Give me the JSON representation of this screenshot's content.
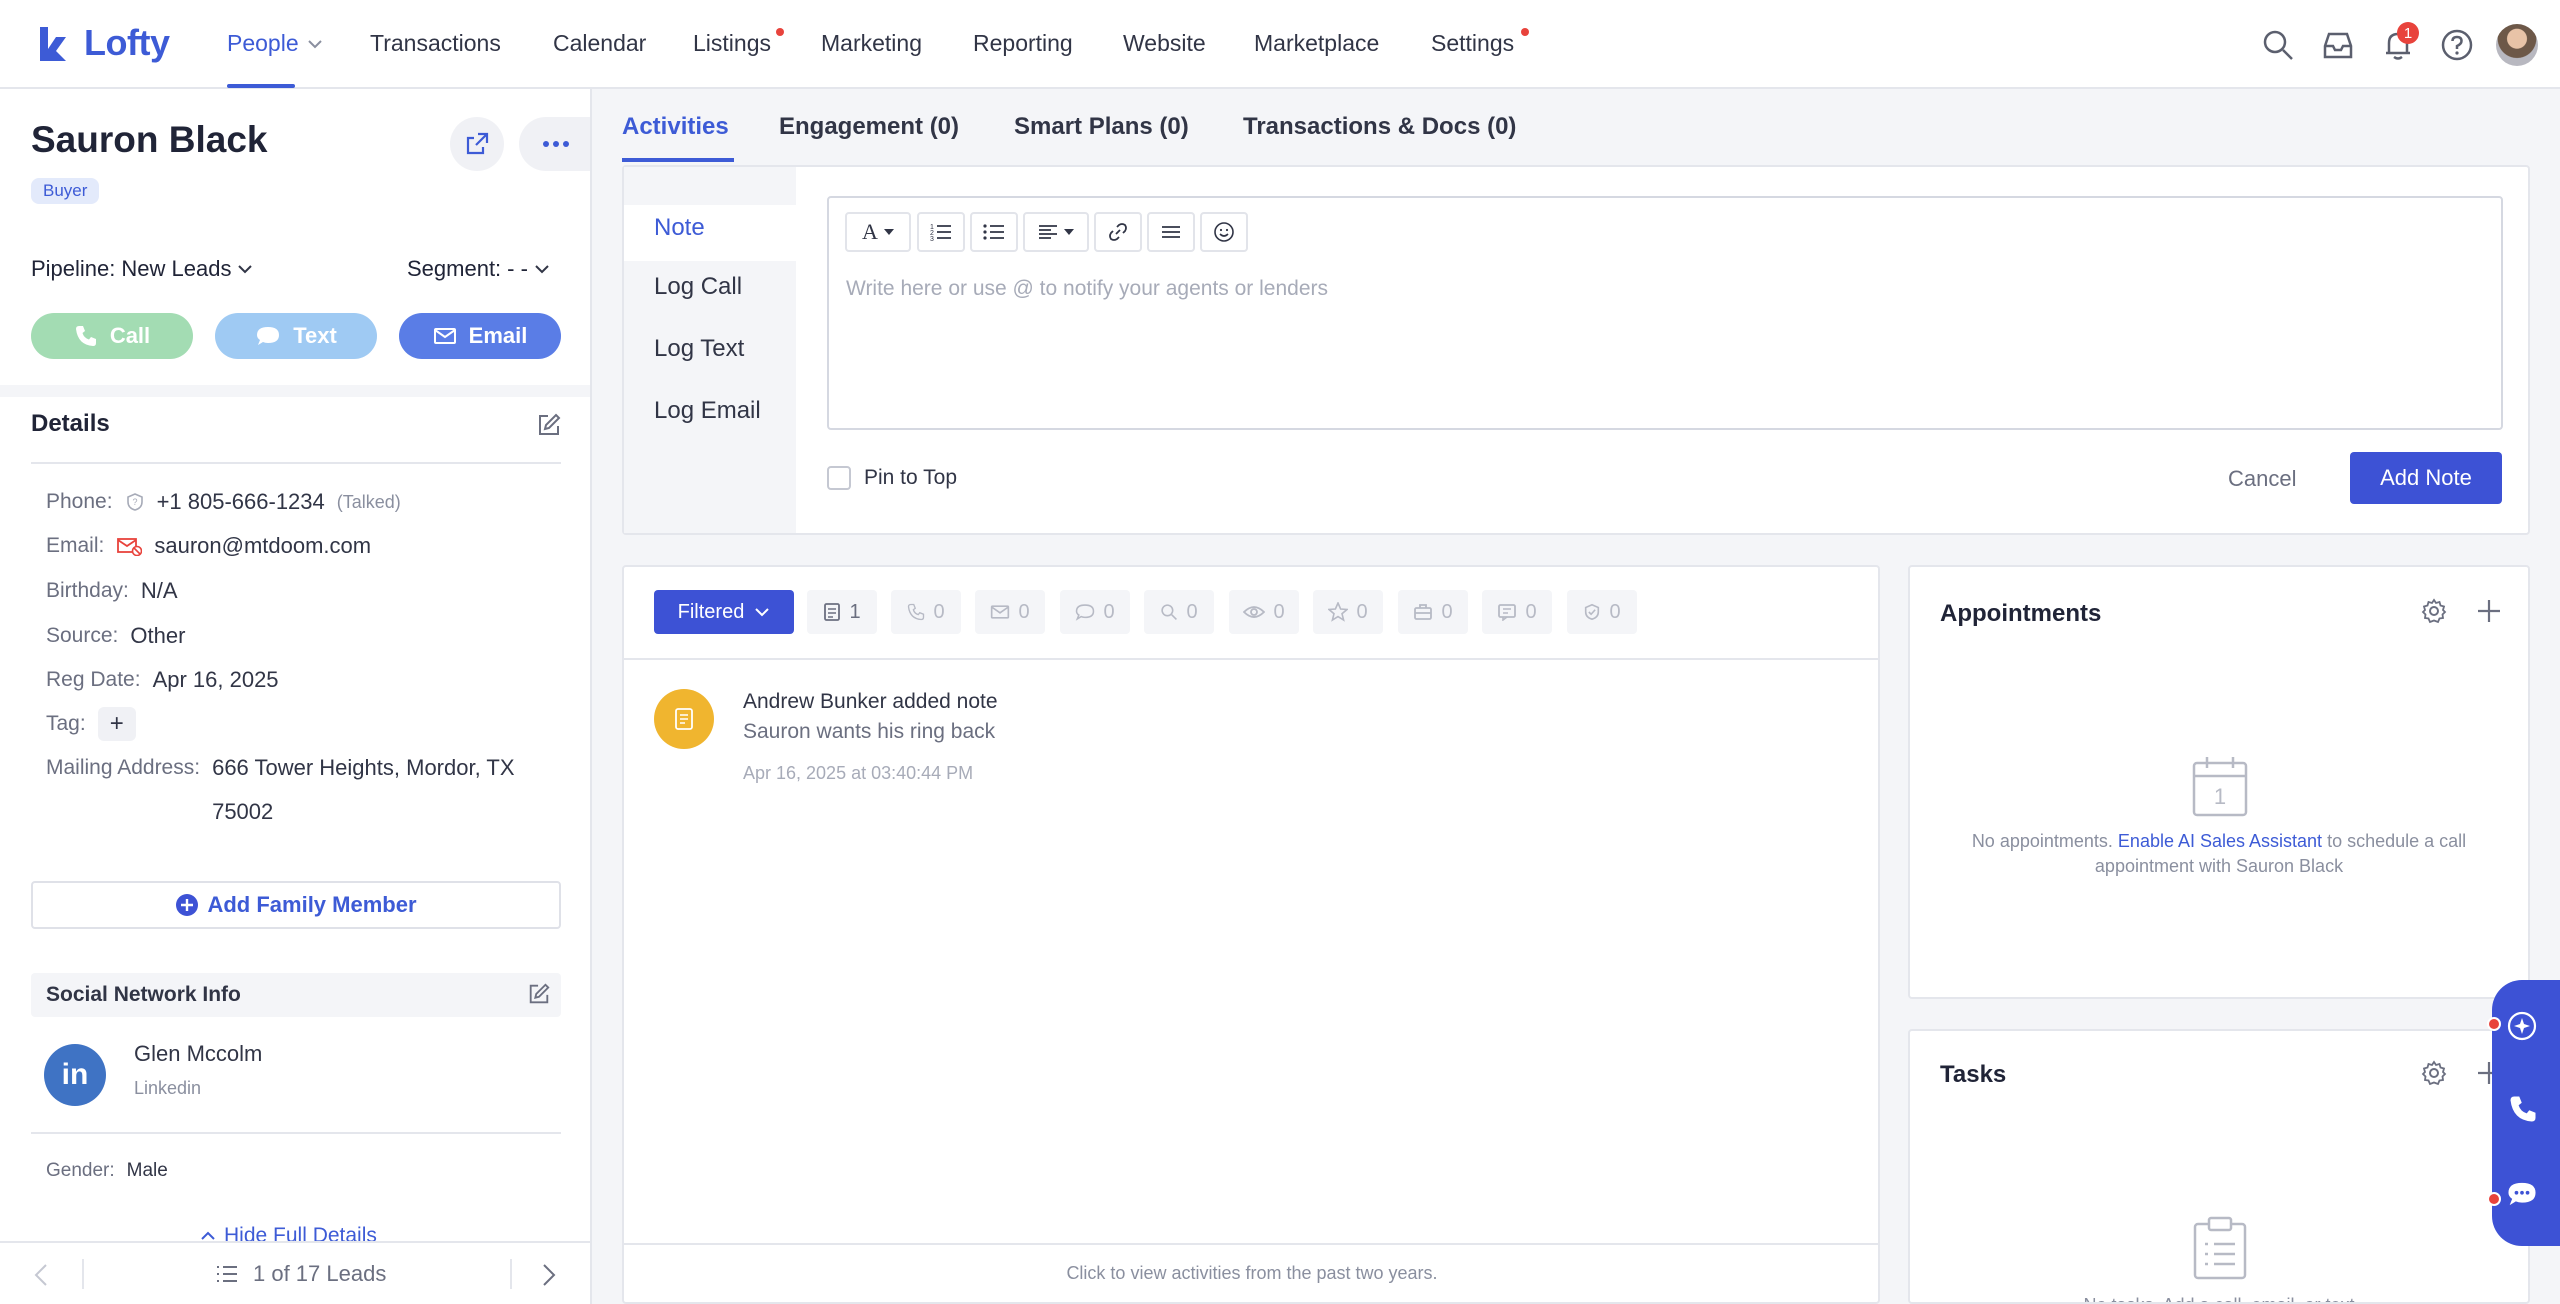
{
  "app": {
    "logo_text": "Lofty"
  },
  "nav": {
    "items": [
      {
        "label": "People"
      },
      {
        "label": "Transactions"
      },
      {
        "label": "Calendar"
      },
      {
        "label": "Listings"
      },
      {
        "label": "Marketing"
      },
      {
        "label": "Reporting"
      },
      {
        "label": "Website"
      },
      {
        "label": "Marketplace"
      },
      {
        "label": "Settings"
      }
    ],
    "notification_count": "1"
  },
  "contact": {
    "name": "Sauron Black",
    "badge": "Buyer",
    "pipeline_label": "Pipeline:",
    "pipeline_value": "New Leads",
    "segment_label": "Segment:",
    "segment_value": "- -",
    "call_label": "Call",
    "text_label": "Text",
    "email_label": "Email"
  },
  "details": {
    "title": "Details",
    "phone_label": "Phone:",
    "phone_value": "+1 805-666-1234",
    "phone_status": "(Talked)",
    "email_label": "Email:",
    "email_value": "sauron@mtdoom.com",
    "birthday_label": "Birthday:",
    "birthday_value": "N/A",
    "source_label": "Source:",
    "source_value": "Other",
    "reg_label": "Reg Date:",
    "reg_value": "Apr 16, 2025",
    "tag_label": "Tag:",
    "address_label": "Mailing Address:",
    "address_line1": "666 Tower Heights, Mordor, TX",
    "address_line2": "75002",
    "add_family_label": "Add Family Member",
    "social_title": "Social Network Info",
    "social_name": "Glen Mccolm",
    "social_network": "Linkedin",
    "gender_label": "Gender:",
    "gender_value": "Male",
    "hide_label": "Hide Full Details"
  },
  "pager": {
    "text": "1 of 17 Leads"
  },
  "tabs": [
    {
      "label": "Activities"
    },
    {
      "label": "Engagement (0)"
    },
    {
      "label": "Smart Plans (0)"
    },
    {
      "label": "Transactions & Docs (0)"
    }
  ],
  "note": {
    "log_items": [
      {
        "label": "Note"
      },
      {
        "label": "Log Call"
      },
      {
        "label": "Log Text"
      },
      {
        "label": "Log Email"
      }
    ],
    "placeholder": "Write here or use @ to notify your agents or lenders",
    "pin_label": "Pin to Top",
    "cancel_label": "Cancel",
    "add_label": "Add Note"
  },
  "feed": {
    "filter_label": "Filtered",
    "chips": [
      {
        "icon": "note-icon",
        "count": "1"
      },
      {
        "icon": "phone-icon",
        "count": "0"
      },
      {
        "icon": "mail-icon",
        "count": "0"
      },
      {
        "icon": "chat-icon",
        "count": "0"
      },
      {
        "icon": "search-icon",
        "count": "0"
      },
      {
        "icon": "eye-icon",
        "count": "0"
      },
      {
        "icon": "star-icon",
        "count": "0"
      },
      {
        "icon": "briefcase-icon",
        "count": "0"
      },
      {
        "icon": "message-icon",
        "count": "0"
      },
      {
        "icon": "shield-check-icon",
        "count": "0"
      }
    ],
    "activity": {
      "title": "Andrew Bunker added note",
      "body": "Sauron wants his ring back",
      "time": "Apr 16, 2025 at 03:40:44 PM"
    },
    "footer": "Click to view activities from the past two years."
  },
  "appointments": {
    "title": "Appointments",
    "empty_pre": "No appointments.",
    "empty_link": "Enable AI Sales Assistant",
    "empty_post": "to schedule a call appointment with Sauron Black"
  },
  "tasks": {
    "title": "Tasks",
    "empty_text": "No tasks. Add a call, email, or text"
  },
  "colors": {
    "brand": "#3d5bd6",
    "primary_button": "#3d52d5",
    "call_pill": "#a3dcb3",
    "text_pill": "#9fcaf3",
    "email_pill": "#5a7de6",
    "note_icon": "#f0b52f",
    "alert": "#e8433c"
  }
}
